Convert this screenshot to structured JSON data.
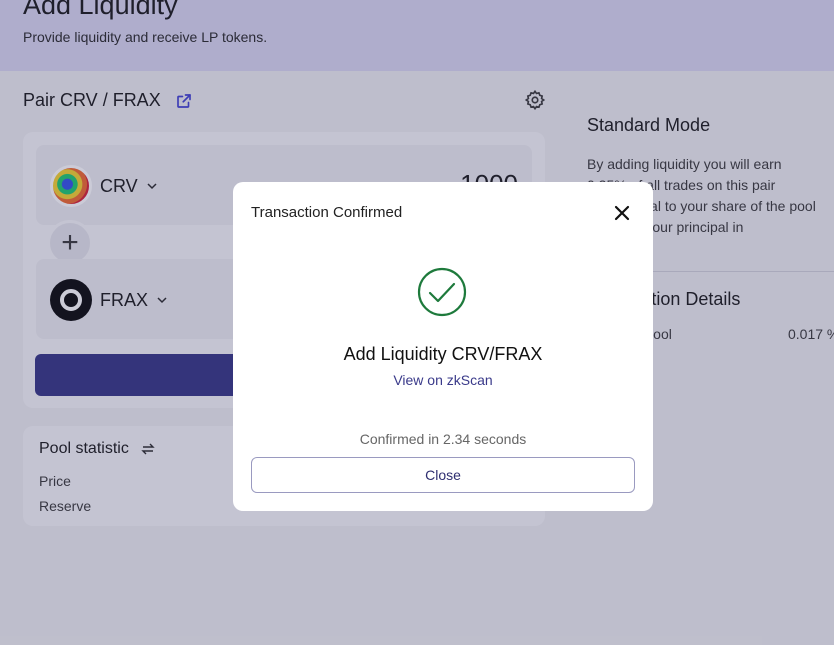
{
  "header": {
    "title": "Add Liquidity",
    "subtitle": "Provide liquidity and receive LP tokens."
  },
  "pair": {
    "label": "Pair CRV / FRAX",
    "external_link_icon": "external-link-icon",
    "settings_icon": "gear-icon"
  },
  "tokens": [
    {
      "symbol": "CRV",
      "amount": "1000"
    },
    {
      "symbol": "FRAX",
      "amount": ""
    }
  ],
  "pool_statistic": {
    "title": "Pool statistic",
    "rows": [
      "Price",
      "Reserve"
    ]
  },
  "right_panel": {
    "mode_title": "Standard Mode",
    "description_lines": [
      "By adding liquidity you will earn",
      "0.25% of all trades on this pair",
      "proportional to your share of the pool",
      "added to your principal in"
    ],
    "details_title": "Transaction Details",
    "detail_row_label": "Share of Pool",
    "detail_row_value": "0.017 %"
  },
  "modal": {
    "title": "Transaction Confirmed",
    "heading": "Add Liquidity CRV/FRAX",
    "link_text": "View on zkScan",
    "confirmed_text": "Confirmed in 2.34 seconds",
    "close_label": "Close",
    "success_color": "#1e7a3c"
  }
}
